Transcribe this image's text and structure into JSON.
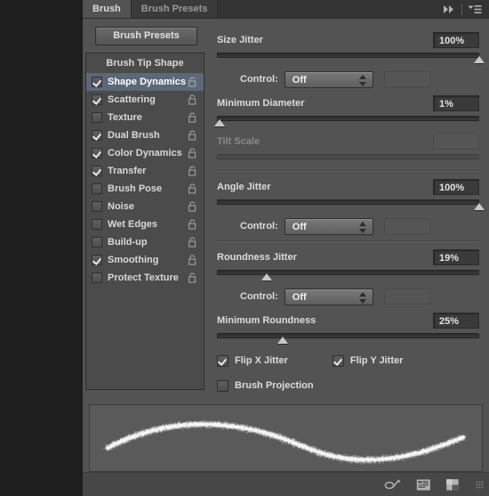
{
  "window": {
    "tabs": [
      {
        "label": "Brush",
        "active": true
      },
      {
        "label": "Brush Presets",
        "active": false
      }
    ],
    "collapse_icon": "double-arrow-right-icon",
    "menu_icon": "panel-menu-icon"
  },
  "sidebar": {
    "presets_button": "Brush Presets",
    "header": "Brush Tip Shape",
    "items": [
      {
        "label": "Shape Dynamics",
        "checked": true,
        "selected": true,
        "locked": false
      },
      {
        "label": "Scattering",
        "checked": true,
        "selected": false,
        "locked": false
      },
      {
        "label": "Texture",
        "checked": false,
        "selected": false,
        "locked": false
      },
      {
        "label": "Dual Brush",
        "checked": true,
        "selected": false,
        "locked": false
      },
      {
        "label": "Color Dynamics",
        "checked": true,
        "selected": false,
        "locked": false
      },
      {
        "label": "Transfer",
        "checked": true,
        "selected": false,
        "locked": false
      },
      {
        "label": "Brush Pose",
        "checked": false,
        "selected": false,
        "locked": false
      },
      {
        "label": "Noise",
        "checked": false,
        "selected": false,
        "locked": false
      },
      {
        "label": "Wet Edges",
        "checked": false,
        "selected": false,
        "locked": false
      },
      {
        "label": "Build-up",
        "checked": false,
        "selected": false,
        "locked": false
      },
      {
        "label": "Smoothing",
        "checked": true,
        "selected": false,
        "locked": false
      },
      {
        "label": "Protect Texture",
        "checked": false,
        "selected": false,
        "locked": false
      }
    ]
  },
  "options": {
    "size_jitter": {
      "label": "Size Jitter",
      "value": "100%",
      "percent": 100
    },
    "size_control": {
      "label": "Control:",
      "value": "Off"
    },
    "minimum_diameter": {
      "label": "Minimum Diameter",
      "value": "1%",
      "percent": 1
    },
    "tilt_scale": {
      "label": "Tilt Scale",
      "value": "",
      "percent": 0,
      "disabled": true
    },
    "angle_jitter": {
      "label": "Angle Jitter",
      "value": "100%",
      "percent": 100
    },
    "angle_control": {
      "label": "Control:",
      "value": "Off"
    },
    "roundness_jitter": {
      "label": "Roundness Jitter",
      "value": "19%",
      "percent": 19
    },
    "roundness_control": {
      "label": "Control:",
      "value": "Off"
    },
    "minimum_roundness": {
      "label": "Minimum Roundness",
      "value": "25%",
      "percent": 25
    },
    "flip_x_jitter": {
      "label": "Flip X Jitter",
      "checked": true
    },
    "flip_y_jitter": {
      "label": "Flip Y Jitter",
      "checked": true
    },
    "brush_projection": {
      "label": "Brush Projection",
      "checked": false
    }
  },
  "footer": {
    "icons": [
      {
        "name": "toggle-brush-tool-icon"
      },
      {
        "name": "new-brush-preset-icon"
      },
      {
        "name": "create-new-brush-icon"
      }
    ],
    "resize_grip": "resize-grip-icon"
  },
  "preview": {
    "label": "brush-stroke-preview"
  }
}
